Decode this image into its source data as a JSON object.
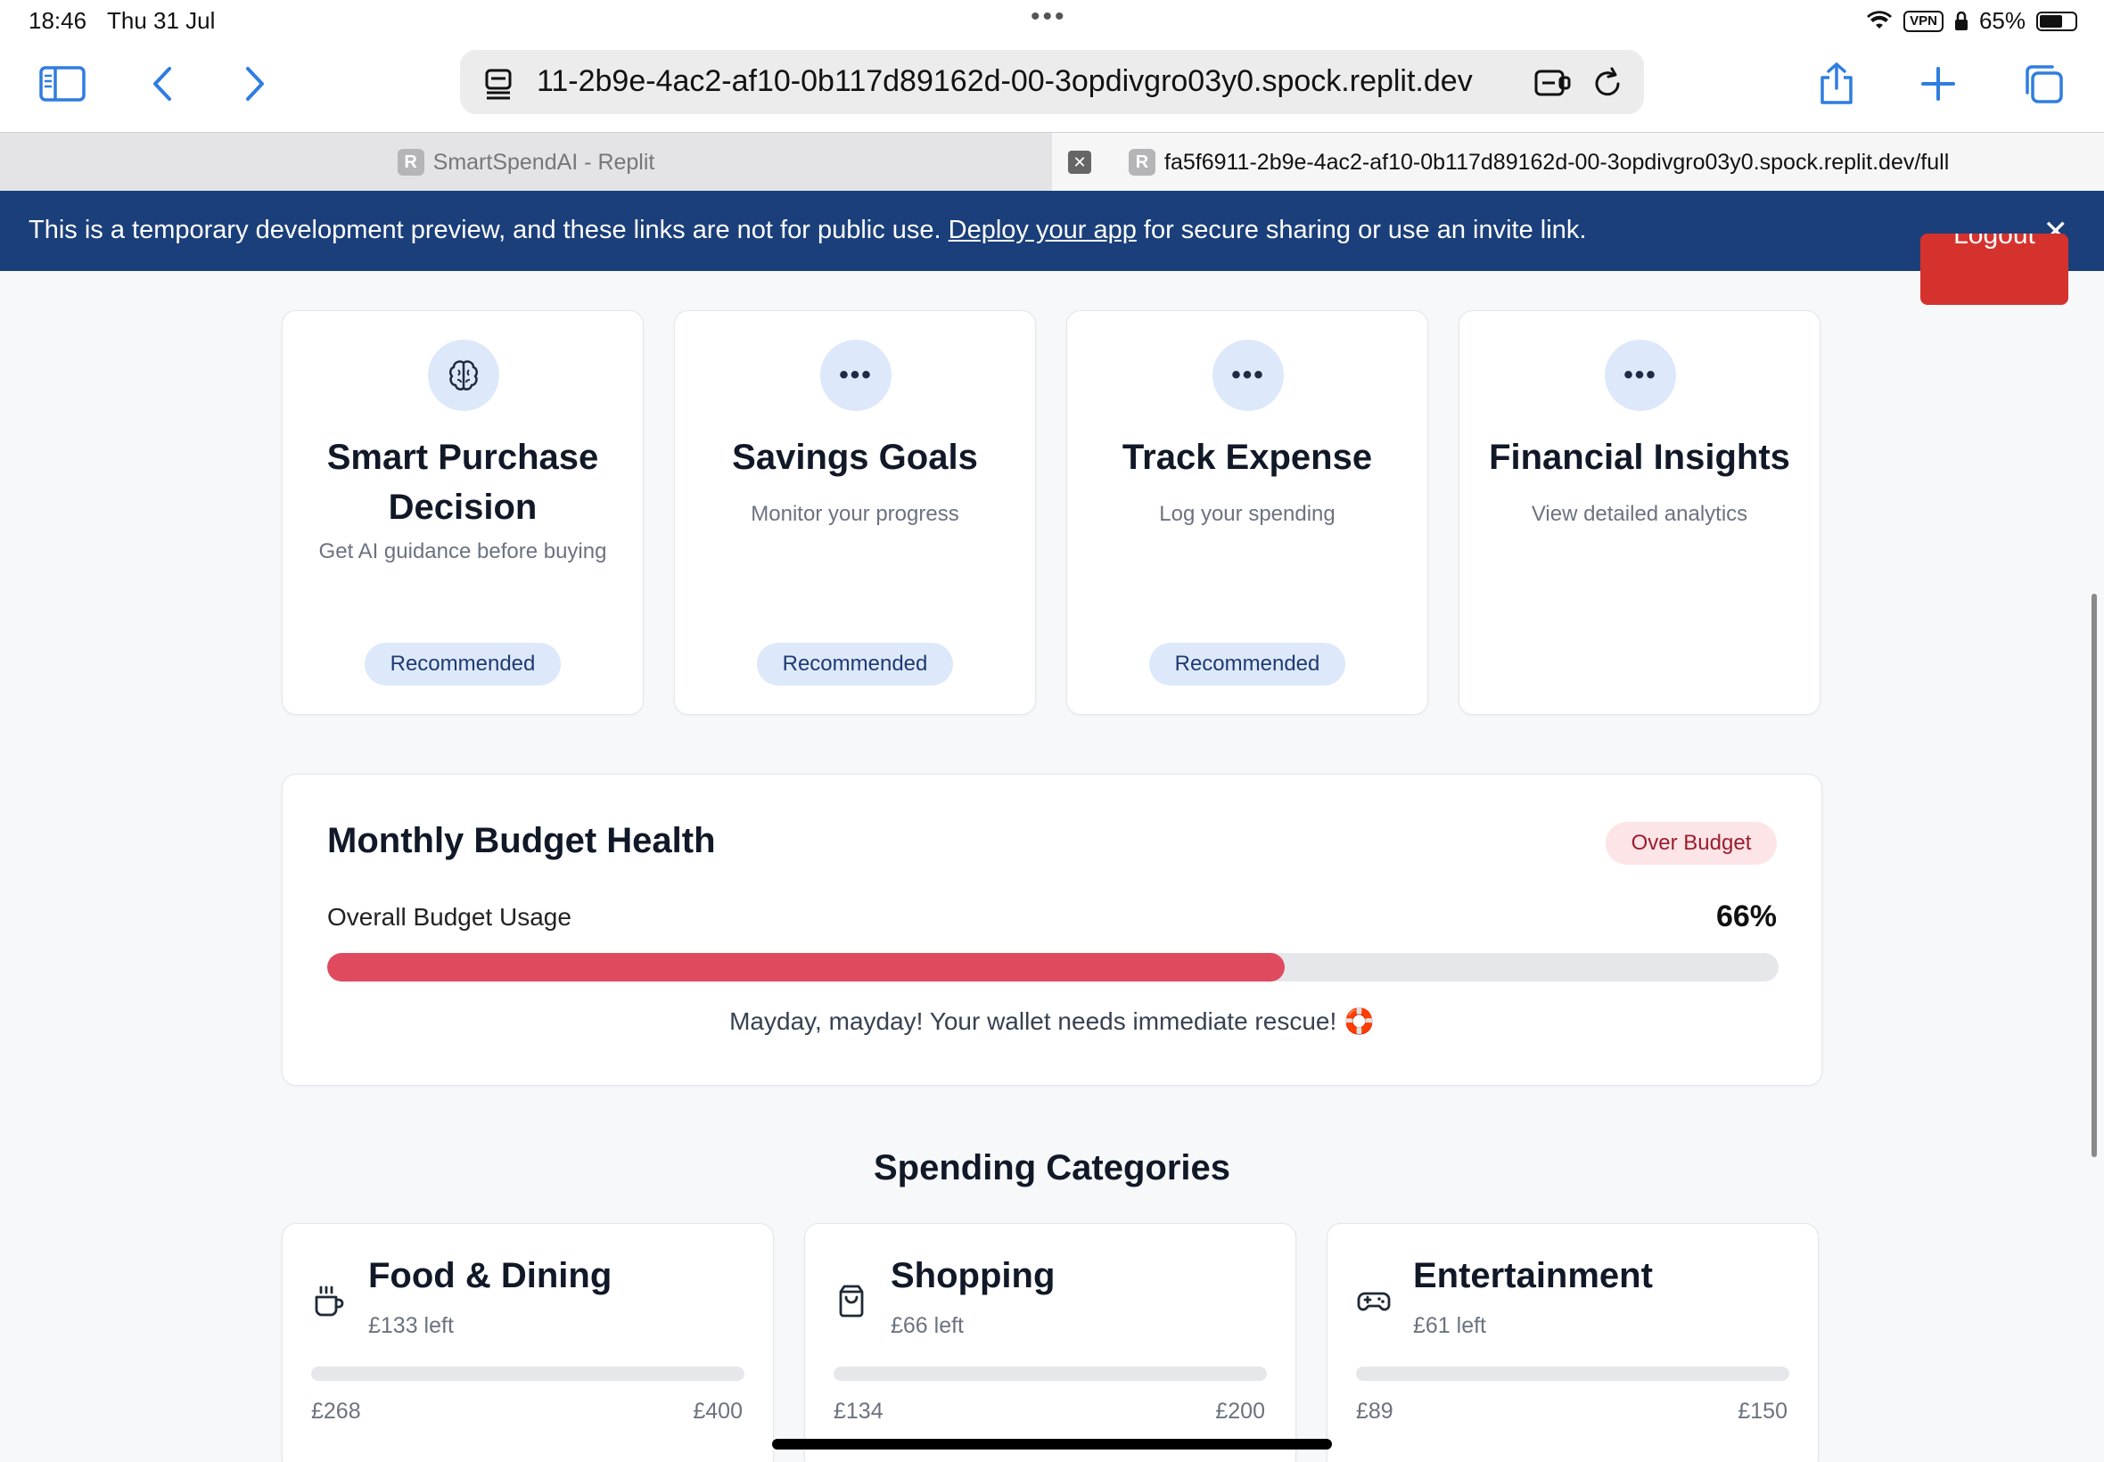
{
  "status_bar": {
    "time": "18:46",
    "date": "Thu 31 Jul",
    "vpn": "VPN",
    "battery": "65%",
    "battery_level": 0.65
  },
  "browser": {
    "url": "11-2b9e-4ac2-af10-0b117d89162d-00-3opdivgro03y0.spock.replit.dev",
    "tabs": [
      {
        "label": "SmartSpendAI - Replit",
        "favicon": "R",
        "active": false
      },
      {
        "label": "fa5f6911-2b9e-4ac2-af10-0b117d89162d-00-3opdivgro03y0.spock.replit.dev/full",
        "favicon": "R",
        "active": true
      }
    ],
    "icons": [
      "sidebar-icon",
      "back-icon",
      "forward-icon",
      "page-menu-icon",
      "extension-icon",
      "reload-icon",
      "share-icon",
      "new-tab-icon",
      "tabs-overview-icon"
    ]
  },
  "banner": {
    "text_before": "This is a temporary development preview, and these links are not for public use.",
    "link": "Deploy your app",
    "text_after": "for secure sharing or use an invite link.",
    "color": "#1b3f7a"
  },
  "header": {
    "logout_label": "Logout"
  },
  "actions": [
    {
      "title": "Smart Purchase Decision",
      "desc": "Get AI guidance before buying",
      "badge": "Recommended",
      "icon": "brain-icon"
    },
    {
      "title": "Savings Goals",
      "desc": "Monitor your progress",
      "badge": "Recommended",
      "icon": "more-icon"
    },
    {
      "title": "Track Expense",
      "desc": "Log your spending",
      "badge": "Recommended",
      "icon": "more-icon"
    },
    {
      "title": "Financial Insights",
      "desc": "View detailed analytics",
      "badge": "",
      "icon": "more-icon"
    }
  ],
  "budget_health": {
    "title": "Monthly Budget Health",
    "status": "Over Budget",
    "usage_label": "Overall Budget Usage",
    "usage_value": "66%",
    "usage_fraction": 0.66,
    "message": "Mayday, mayday! Your wallet needs immediate rescue! 🛟",
    "bar_color": "#e04a5f"
  },
  "categories": {
    "heading": "Spending Categories",
    "items": [
      {
        "name": "Food & Dining",
        "left": "£133 left",
        "spent": "£268",
        "limit": "£400",
        "icon": "coffee-cup-icon"
      },
      {
        "name": "Shopping",
        "left": "£66 left",
        "spent": "£134",
        "limit": "£200",
        "icon": "shopping-bag-icon"
      },
      {
        "name": "Entertainment",
        "left": "£61 left",
        "spent": "£89",
        "limit": "£150",
        "icon": "gamepad-icon"
      }
    ]
  }
}
